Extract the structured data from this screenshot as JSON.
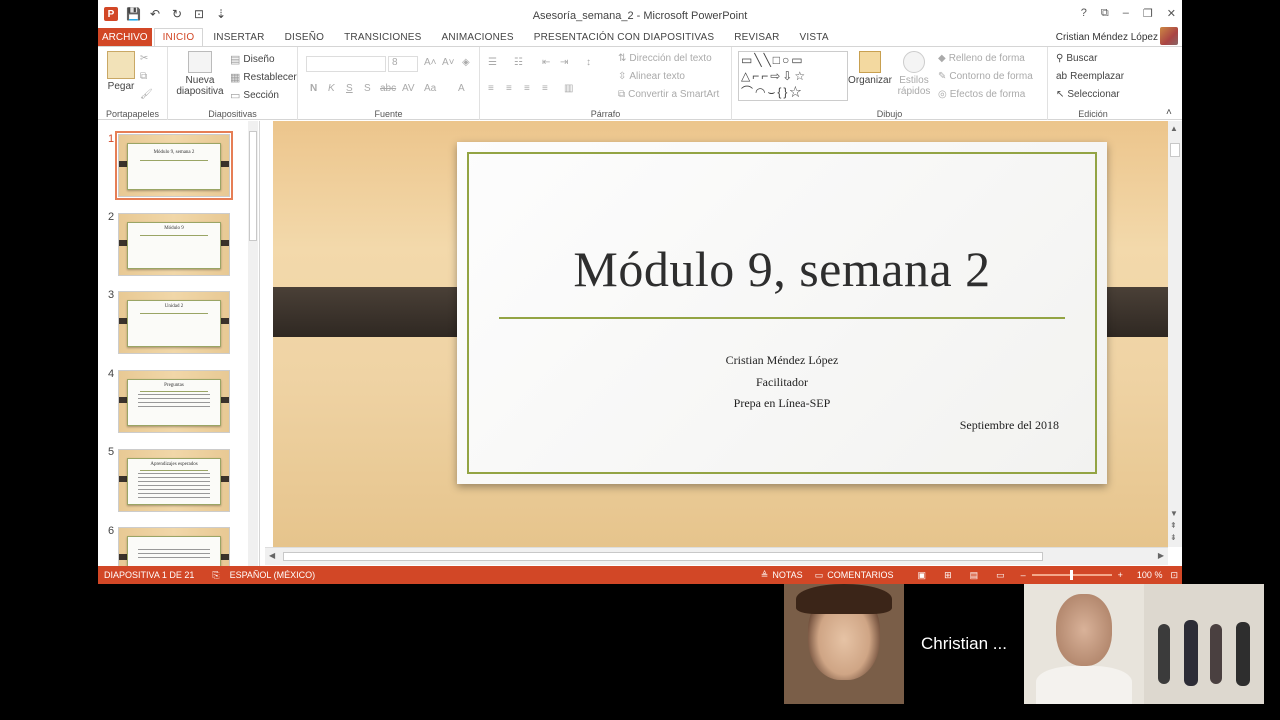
{
  "window": {
    "doc_title": "Asesoría_semana_2 - Microsoft PowerPoint",
    "controls": [
      "?",
      "⧉",
      "–",
      "❐",
      "✕"
    ]
  },
  "tabs": {
    "file": "ARCHIVO",
    "items": [
      "INICIO",
      "INSERTAR",
      "DISEÑO",
      "TRANSICIONES",
      "ANIMACIONES",
      "PRESENTACIÓN CON DIAPOSITIVAS",
      "REVISAR",
      "VISTA"
    ],
    "active": "INICIO"
  },
  "user": {
    "name": "Cristian Méndez López"
  },
  "ribbon": {
    "clipboard": {
      "label": "Portapapeles",
      "paste": "Pegar"
    },
    "slides": {
      "label": "Diapositivas",
      "new_slide_1": "Nueva",
      "new_slide_2": "diapositiva",
      "layout": "Diseño",
      "reset": "Restablecer",
      "section": "Sección"
    },
    "font": {
      "label": "Fuente",
      "size": "8",
      "bold": "N",
      "italic": "K",
      "underline": "S",
      "strike": "S",
      "shadow": "abc",
      "spacing": "AV",
      "case": "Aa",
      "color": "A"
    },
    "paragraph": {
      "label": "Párrafo",
      "text_direction": "Dirección del texto",
      "align_text": "Alinear texto",
      "smartart": "Convertir a SmartArt"
    },
    "drawing": {
      "label": "Dibujo",
      "arrange": "Organizar",
      "quick_styles_1": "Estilos",
      "quick_styles_2": "rápidos",
      "fill": "Relleno de forma",
      "outline": "Contorno de forma",
      "effects": "Efectos de forma"
    },
    "editing": {
      "label": "Edición",
      "find": "Buscar",
      "replace": "Reemplazar",
      "select": "Seleccionar"
    }
  },
  "thumbnails": [
    {
      "num": "1",
      "title": "Módulo 9, semana 2",
      "selected": true
    },
    {
      "num": "2",
      "title": "Módulo 9",
      "selected": false
    },
    {
      "num": "3",
      "title": "Unidad 2",
      "selected": false
    },
    {
      "num": "4",
      "title": "Preguntas",
      "selected": false
    },
    {
      "num": "5",
      "title": "Aprendizajes esperados",
      "selected": false
    },
    {
      "num": "6",
      "title": "",
      "selected": false
    }
  ],
  "slide": {
    "title": "Módulo 9, semana 2",
    "author": "Cristian Méndez López",
    "role": "Facilitador",
    "org": "Prepa en Línea-SEP",
    "date": "Septiembre del 2018"
  },
  "status": {
    "slide_count": "DIAPOSITIVA 1 DE 21",
    "language": "ESPAÑOL (MÉXICO)",
    "notes": "NOTAS",
    "comments": "COMENTARIOS",
    "zoom": "100 %"
  },
  "participants": {
    "name_tile": "Christian ..."
  },
  "colors": {
    "accent": "#d24726",
    "slide_frame": "#93a444",
    "band": "#3a322b"
  }
}
